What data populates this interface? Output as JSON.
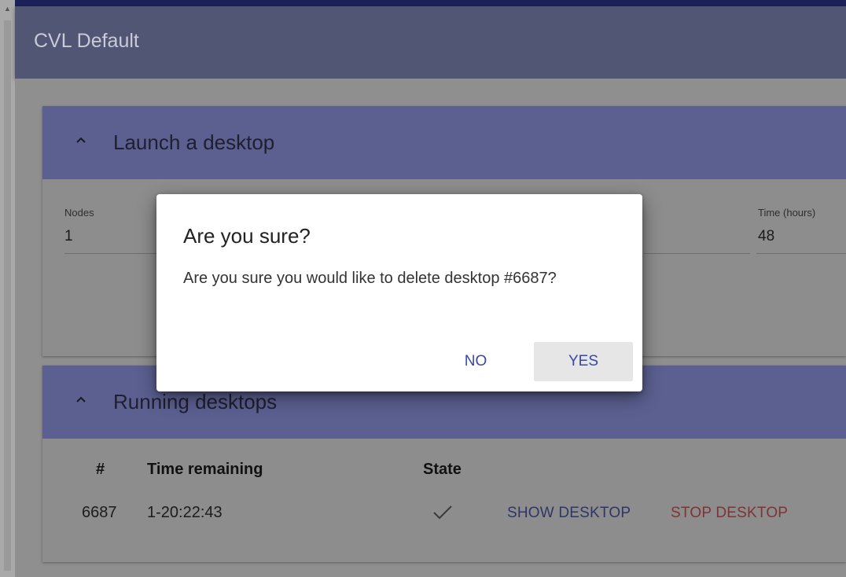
{
  "app": {
    "title": "CVL Default"
  },
  "launch_panel": {
    "title": "Launch a desktop",
    "expanded": true,
    "fields": {
      "nodes": {
        "label": "Nodes",
        "value": "1"
      },
      "time": {
        "label": "Time (hours)",
        "value": "48"
      }
    }
  },
  "running_panel": {
    "title": "Running desktops",
    "expanded": true,
    "columns": [
      "#",
      "Time remaining",
      "State"
    ],
    "rows": [
      {
        "id": "6687",
        "time_remaining": "1-20:22:43",
        "state_icon": "check-icon",
        "show_label": "SHOW DESKTOP",
        "stop_label": "STOP DESKTOP"
      }
    ]
  },
  "dialog": {
    "title": "Are you sure?",
    "message": "Are you sure you would like to delete desktop #6687?",
    "no_label": "NO",
    "yes_label": "YES"
  },
  "colors": {
    "appbar": "#525675",
    "panel_header": "#5c6091",
    "accent": "#3a47a8",
    "danger": "#7e3434"
  }
}
